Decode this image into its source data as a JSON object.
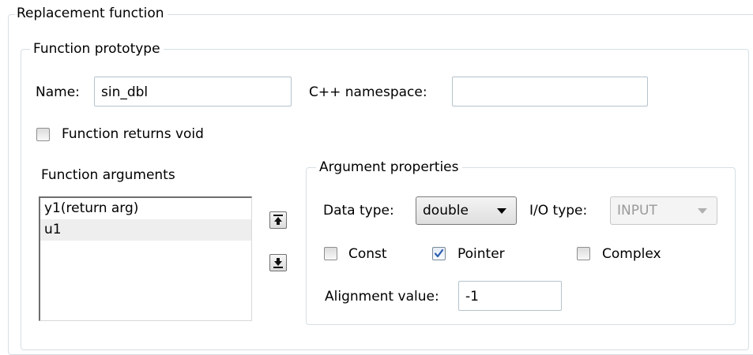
{
  "replacement_group": {
    "title": "Replacement function"
  },
  "prototype_group": {
    "title": "Function prototype"
  },
  "name_field": {
    "label": "Name:",
    "value": "sin_dbl"
  },
  "namespace_field": {
    "label": "C++ namespace:",
    "value": ""
  },
  "returns_void": {
    "label": "Function returns void",
    "checked": false
  },
  "arguments": {
    "title": "Function arguments",
    "items": [
      {
        "label": "y1(return arg)",
        "selected": false
      },
      {
        "label": "u1",
        "selected": true
      }
    ],
    "move_up_icon": "arrow-up-bar-icon",
    "move_down_icon": "arrow-down-bar-icon"
  },
  "argument_properties": {
    "title": "Argument properties",
    "data_type": {
      "label": "Data type:",
      "value": "double"
    },
    "io_type": {
      "label": "I/O type:",
      "value": "INPUT",
      "disabled": true
    },
    "const": {
      "label": "Const",
      "checked": false
    },
    "pointer": {
      "label": "Pointer",
      "checked": true
    },
    "complex": {
      "label": "Complex",
      "checked": false
    },
    "alignment": {
      "label": "Alignment value:",
      "value": "-1"
    }
  },
  "colors": {
    "group_border": "#d5dfe5",
    "selected_row": "#eeeeee",
    "check_mark": "#2f5fb2"
  }
}
